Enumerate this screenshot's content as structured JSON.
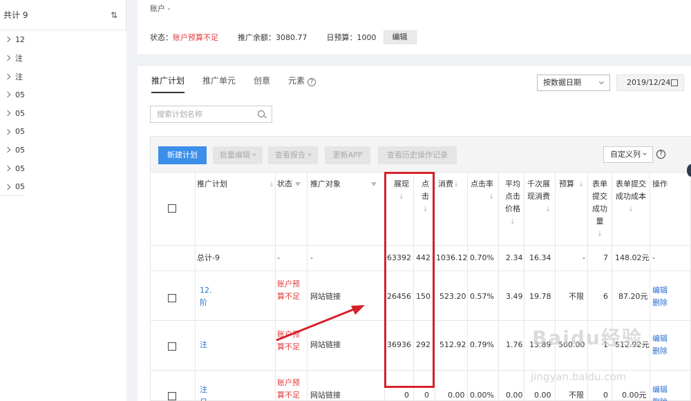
{
  "sidebar": {
    "total_label": "共计 9",
    "items": [
      "12",
      "注",
      "注",
      "05",
      "05",
      "05",
      "05",
      "05",
      "05"
    ]
  },
  "account": {
    "title": "账户 -",
    "status_label": "状态：",
    "status_value": "账户预算不足",
    "balance_label": "推广余额：",
    "balance_value": "3080.77",
    "daily_label": "日预算：",
    "daily_value": "1000",
    "edit_label": "编辑"
  },
  "tabs": [
    {
      "label": "推广计划",
      "active": true
    },
    {
      "label": "推广单元",
      "active": false
    },
    {
      "label": "创意",
      "active": false
    },
    {
      "label": "元素",
      "active": false
    }
  ],
  "date_mode": "按数据日期",
  "date_value": "2019/12/24",
  "search_placeholder": "搜索计划名称",
  "toolbar": {
    "new_plan": "新建计划",
    "batch_edit": "批量编辑",
    "view_report": "查看报告",
    "update_app": "更新APP",
    "history": "查看历史操作记录",
    "custom_cols": "自定义列"
  },
  "table": {
    "headers": {
      "plan": "推广计划",
      "status": "状态",
      "target": "推广对象",
      "impressions_1": "展现",
      "clicks_1": "点",
      "clicks_2": "击",
      "cost": "消费",
      "ctr": "点击率",
      "avg_1": "平均",
      "avg_2": "点击",
      "avg_3": "价格",
      "cpm_1": "千次展",
      "cpm_2": "现消费",
      "budget": "预算",
      "form_1": "表单",
      "form_2": "提交",
      "form_3": "成功",
      "form_4": "量",
      "formcost_1": "表单提交",
      "formcost_2": "成功成本",
      "ops": "操作"
    },
    "total_row": {
      "plan": "总计-9",
      "status": "-",
      "target": "-",
      "impressions": "63392",
      "clicks": "442",
      "cost": "1036.12",
      "ctr": "0.70%",
      "avg": "2.34",
      "cpm": "16.34",
      "budget": "-",
      "forms": "7",
      "formcost": "148.02元",
      "ops": "-"
    },
    "rows": [
      {
        "plan_1": "12.",
        "plan_2": "阶",
        "status_1": "账户预",
        "status_2": "算不足",
        "target": "网站链接",
        "impressions": "26456",
        "clicks": "150",
        "cost": "523.20",
        "ctr": "0.57%",
        "avg": "3.49",
        "cpm": "19.78",
        "budget": "不限",
        "forms": "6",
        "formcost": "87.20元",
        "op_edit": "编辑",
        "op_delete": "删除"
      },
      {
        "plan_1": "注",
        "plan_2": "",
        "status_1": "账户预",
        "status_2": "算不足",
        "target": "网站链接",
        "impressions": "36936",
        "clicks": "292",
        "cost": "512.92",
        "ctr": "0.79%",
        "avg": "1.76",
        "cpm": "13.89",
        "budget": "500.00",
        "forms": "1",
        "formcost": "512.92元",
        "op_edit": "编辑",
        "op_delete": "删除"
      },
      {
        "plan_1": "注",
        "plan_2": "日",
        "status_1": "账户预",
        "status_2": "算不足",
        "target": "网站链接",
        "impressions": "0",
        "clicks": "0",
        "cost": "0.00",
        "ctr": "0.00%",
        "avg": "0.00",
        "cpm": "0.00",
        "budget": "不限",
        "forms": "0",
        "formcost": "0.00元",
        "op_edit": "编辑",
        "op_delete": "删除"
      }
    ]
  },
  "watermark": "Baidu经验",
  "watermark_url": "jingyan.baidu.com",
  "colors": {
    "primary": "#3c8fe9",
    "alert_red": "#e23a3a",
    "highlight_box": "#d6222a",
    "link_blue": "#2b6fd0"
  }
}
